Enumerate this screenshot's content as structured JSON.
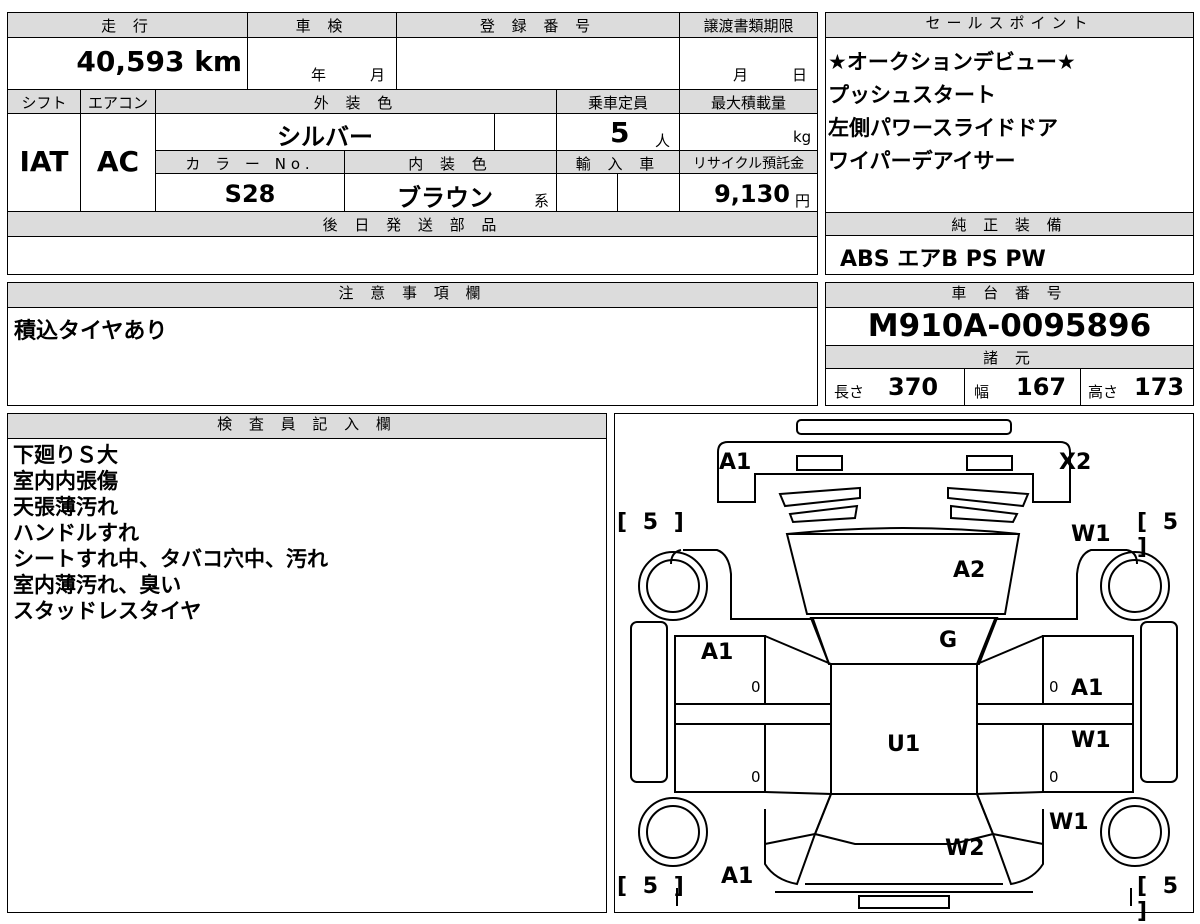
{
  "sheet": {
    "mileage_header": "走 行",
    "mileage": "40,593 km",
    "inspection_header": "車 検",
    "inspection_year_unit": "年",
    "inspection_month_unit": "月",
    "registration_header": "登 録 番 号",
    "transfer_header": "譲渡書類期限",
    "transfer_month_unit": "月",
    "transfer_day_unit": "日",
    "shift_header": "シフト",
    "shift": "IAT",
    "ac_header": "エアコン",
    "ac": "AC",
    "exterior_color_header": "外 装 色",
    "exterior_color": "シルバー",
    "capacity_header": "乗車定員",
    "capacity": "5",
    "capacity_unit": "人",
    "max_load_header": "最大積載量",
    "max_load_unit": "kg",
    "color_no_header": "カ ラ ー No.",
    "color_no": "S28",
    "interior_color_header": "内 装 色",
    "interior_color": "ブラウン",
    "interior_color_suffix": "系",
    "import_header": "輸 入 車",
    "recycle_header": "リサイクル預託金",
    "recycle_fee": "9,130",
    "recycle_unit": "円",
    "later_parts_header": "後 日 発 送 部 品"
  },
  "sales_points": {
    "header": "セールスポイント",
    "items": [
      "★オークションデビュー★",
      "プッシュスタート",
      "左側パワースライドドア",
      "ワイパーデアイサー"
    ]
  },
  "genuine_equipment": {
    "header": "純 正 装 備",
    "value": "ABS エアB PS PW"
  },
  "notes": {
    "header": "注 意 事 項 欄",
    "text": "積込タイヤあり"
  },
  "chassis": {
    "header": "車 台 番 号",
    "number": "M910A-0095896",
    "specs_header": "諸 元",
    "length_label": "長さ",
    "length": "370",
    "width_label": "幅",
    "width": "167",
    "height_label": "高さ",
    "height": "173"
  },
  "inspector": {
    "header": "検 査 員 記 入 欄",
    "lines": [
      "下廻りＳ大",
      "室内内張傷",
      "天張薄汚れ",
      "ハンドルすれ",
      "シートすれ中、タバコ穴中、汚れ",
      "室内薄汚れ、臭い",
      "スタッドレスタイヤ"
    ]
  },
  "diagram": {
    "marks": {
      "front_left": "A1",
      "front_right": "X2",
      "hood": "A2",
      "windshield": "G",
      "roof": "U1",
      "left_front_door": "A1",
      "right_front_door": "A1",
      "right_rear_door": "W1",
      "right_front_fender": "W1",
      "right_rear_qtr": "W1",
      "rear_glass": "W2",
      "rear_left": "A1"
    },
    "tread": {
      "front_left": "5",
      "front_right": "5",
      "rear_left": "5",
      "rear_right": "5"
    },
    "zeros": [
      "0",
      "0",
      "0",
      "0"
    ]
  }
}
